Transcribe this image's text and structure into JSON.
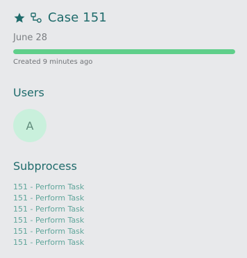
{
  "header": {
    "case_title": "Case 151",
    "date": "June 28",
    "progress_fraction": 1.0,
    "created": "Created 9 minutes ago",
    "icons": [
      "star-icon",
      "process-flow-icon"
    ]
  },
  "users": {
    "title": "Users",
    "avatars": [
      {
        "initial": "A"
      }
    ]
  },
  "subprocess": {
    "title": "Subprocess",
    "items": [
      "151 - Perform Task",
      "151 - Perform Task",
      "151 - Perform Task",
      "151 - Perform Task",
      "151 - Perform Task",
      "151 - Perform Task"
    ]
  },
  "colors": {
    "accent": "#1f6b6b",
    "progress": "#5fcf8a",
    "avatar_bg": "#c9f0dc",
    "link": "#5fa59a",
    "background": "#e8e9eb"
  }
}
